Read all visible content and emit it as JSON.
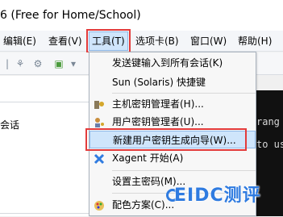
{
  "window": {
    "title": "6 (Free for Home/School)"
  },
  "menubar": {
    "edit": "编辑(E)",
    "view": "查看(V)",
    "tools": "工具(T)",
    "tabs": "选项卡(B)",
    "window": "窗口(W)",
    "help": "帮助(H)"
  },
  "leftpanel": {
    "sessions_label": "会话"
  },
  "terminal": {
    "line1": "rang C",
    "line2": "to us"
  },
  "tools_menu": {
    "items": [
      {
        "label": "发送键输入到所有会话(K)",
        "icon": ""
      },
      {
        "label": "Sun (Solaris) 快捷键",
        "icon": ""
      },
      {
        "label": "主机密钥管理者(H)...",
        "icon": "host-key-icon"
      },
      {
        "label": "用户密钥管理者(U)...",
        "icon": "user-key-icon"
      },
      {
        "label": "新建用户密钥生成向导(W)...",
        "icon": ""
      },
      {
        "label": "Xagent 开始(A)",
        "icon": "xagent-icon"
      },
      {
        "label": "设置主密码(M)...",
        "icon": ""
      },
      {
        "label": "配色方案(C)...",
        "icon": "palette-icon"
      }
    ]
  },
  "watermark": {
    "text": "EIDC测评"
  },
  "colors": {
    "highlight_border": "#e33b3b",
    "selection": "#cfe5fb",
    "watermark": "#2f7be0"
  }
}
